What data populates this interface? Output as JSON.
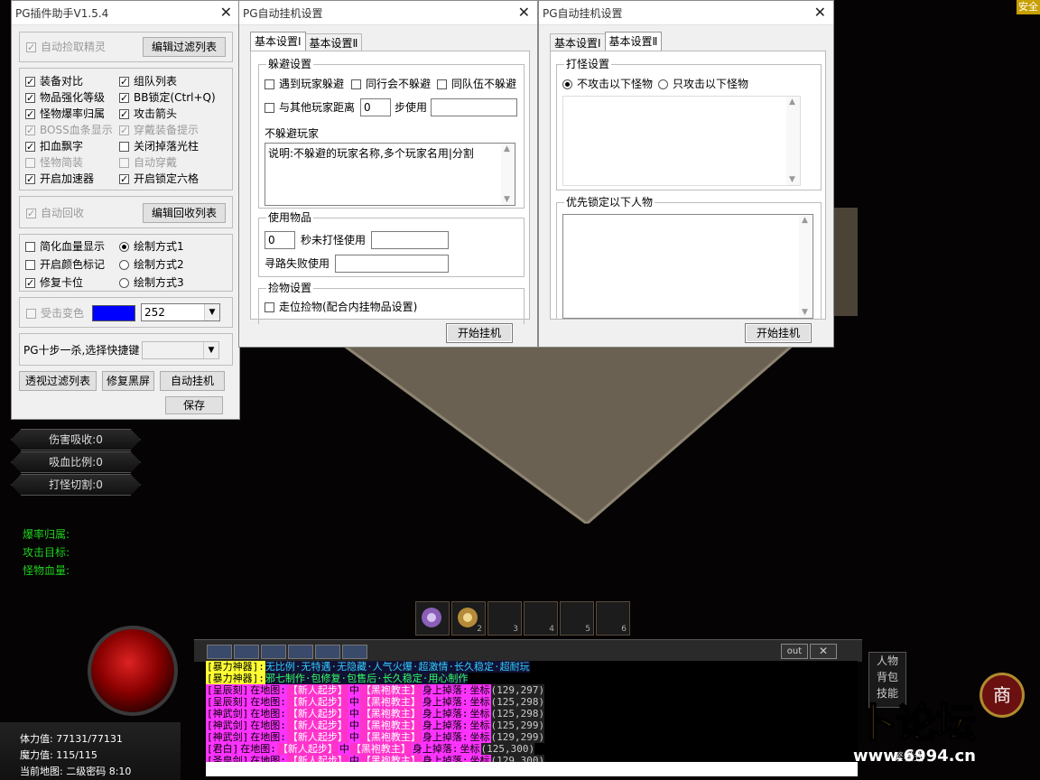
{
  "game": {
    "safe_badge": "安全",
    "side_buttons": [
      "伤害吸收:0",
      "吸血比例:0",
      "打怪切割:0"
    ],
    "green_labels": [
      "爆率归属:",
      "攻击目标:",
      "怪物血量:"
    ],
    "hotbar_slots": [
      "",
      "2",
      "3",
      "4",
      "5",
      "6"
    ],
    "chat_buttons": [
      "out"
    ],
    "chat_lines": [
      {
        "head": "[暴力神器]:",
        "text": "无比例·无特遇·无隐藏·人气火爆·超激情·长久稳定·超耐玩"
      },
      {
        "head": "[暴力神器]:",
        "text": "邪七制作·包修复·包售后·长久稳定·用心制作"
      }
    ],
    "system_lines": [
      {
        "name": "[呈辰刻]",
        "coord": "(129,297)"
      },
      {
        "name": "[呈辰刻]",
        "coord": "(125,298)"
      },
      {
        "name": "[神武剑]",
        "coord": "(125,298)"
      },
      {
        "name": "[神武剑]",
        "coord": "(125,299)"
      },
      {
        "name": "[神武剑]",
        "coord": "(129,299)"
      },
      {
        "name": "[君白]",
        "coord": "(125,300)"
      },
      {
        "name": "[圣皇剑]",
        "coord": "(129,300)"
      }
    ],
    "system_parts": {
      "a": "在地图:",
      "b": "【新人起步】",
      "c": "中",
      "d": "【黑袍教主】",
      "e": "身上掉落:",
      "f": "坐标"
    },
    "stats": {
      "hp_label": "体力值:",
      "hp_value": "77131/77131",
      "mp_label": "魔力值:",
      "mp_value": "115/115",
      "map_label": "当前地图:",
      "map_value": "二级密码 8:10"
    },
    "right_panel_labels": [
      "人物",
      "背包",
      "技能"
    ],
    "shop_badge": "商",
    "logo_text": "萝卜论坛",
    "logo_url": "www.6994.cn",
    "mode_text": "繁模式"
  },
  "plugin": {
    "title": "PG插件助手V1.5.4",
    "auto_pick": "自动捡取精灵",
    "edit_filter": "编辑过滤列表",
    "options_left": [
      {
        "label": "装备对比",
        "checked": true,
        "disabled": false
      },
      {
        "label": "物品强化等级",
        "checked": true,
        "disabled": false
      },
      {
        "label": "怪物爆率归属",
        "checked": true,
        "disabled": false
      },
      {
        "label": "BOSS血条显示",
        "checked": true,
        "disabled": true
      },
      {
        "label": "扣血飘字",
        "checked": true,
        "disabled": false
      },
      {
        "label": "怪物简装",
        "checked": false,
        "disabled": true
      },
      {
        "label": "开启加速器",
        "checked": true,
        "disabled": false
      }
    ],
    "options_right": [
      {
        "label": "组队列表",
        "checked": true,
        "disabled": false
      },
      {
        "label": "BB锁定(Ctrl+Q)",
        "checked": true,
        "disabled": false
      },
      {
        "label": "攻击箭头",
        "checked": true,
        "disabled": false
      },
      {
        "label": "穿戴装备提示",
        "checked": true,
        "disabled": true
      },
      {
        "label": "关闭掉落光柱",
        "checked": false,
        "disabled": false
      },
      {
        "label": "自动穿戴",
        "checked": false,
        "disabled": true
      },
      {
        "label": "开启锁定六格",
        "checked": true,
        "disabled": false
      }
    ],
    "auto_recycle": "自动回收",
    "edit_recycle": "编辑回收列表",
    "display_left": [
      {
        "label": "简化血量显示",
        "checked": false
      },
      {
        "label": "开启颜色标记",
        "checked": false
      },
      {
        "label": "修复卡位",
        "checked": true
      }
    ],
    "display_right": [
      {
        "label": "绘制方式1",
        "checked": true
      },
      {
        "label": "绘制方式2",
        "checked": false
      },
      {
        "label": "绘制方式3",
        "checked": false
      }
    ],
    "hit_color": "受击变色",
    "hit_color_swatch": "#0000ff",
    "hit_color_value": "252",
    "shortcut_label": "PG十步一杀,选择快捷键",
    "btn_filter": "透视过滤列表",
    "btn_black": "修复黑屏",
    "btn_auto": "自动挂机",
    "btn_save": "保存"
  },
  "auto1": {
    "title": "PG自动挂机设置",
    "tabs": [
      "基本设置Ⅰ",
      "基本设置Ⅱ"
    ],
    "avoid_title": "躲避设置",
    "avoid_opts": [
      "遇到玩家躲避",
      "同行会不躲避",
      "同队伍不躲避"
    ],
    "distance_label": "与其他玩家距离",
    "distance_value": "0",
    "step_use": "步使用",
    "no_avoid_title": "不躲避玩家",
    "no_avoid_text": "说明:不躲避的玩家名称,多个玩家名用|分割",
    "use_items_title": "使用物品",
    "sec_value": "0",
    "sec_label": "秒未打怪使用",
    "path_fail": "寻路失败使用",
    "pick_title": "捡物设置",
    "pick_opt": "走位捡物(配合内挂物品设置)",
    "start": "开始挂机"
  },
  "auto2": {
    "title": "PG自动挂机设置",
    "tabs": [
      "基本设置Ⅰ",
      "基本设置Ⅱ"
    ],
    "monster_title": "打怪设置",
    "radio1": "不攻击以下怪物",
    "radio2": "只攻击以下怪物",
    "priority_title": "优先锁定以下人物",
    "start": "开始挂机"
  }
}
